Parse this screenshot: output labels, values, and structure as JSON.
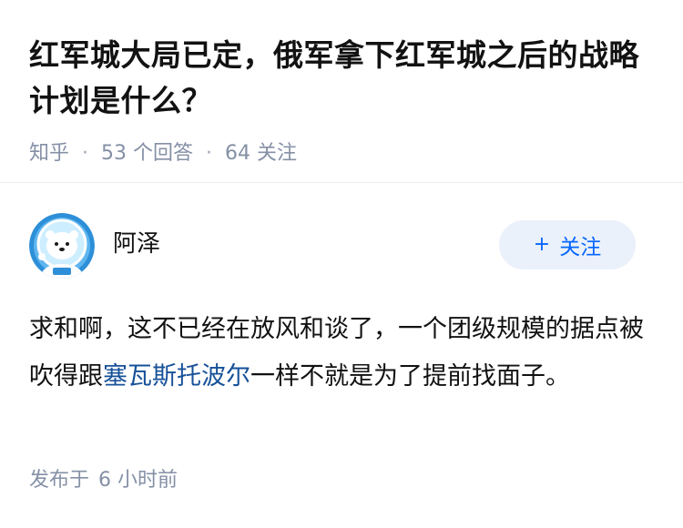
{
  "question": {
    "title": "红军城大局已定，俄军拿下红军城之后的战略计划是什么？",
    "source": "知乎",
    "answer_count": "53",
    "answer_label": "个回答",
    "follower_count": "64",
    "follower_label": "关注",
    "separator": "·"
  },
  "answer": {
    "author_name": "阿泽",
    "avatar_icon": "polar-bear-avatar-icon",
    "follow_button_label": "关注",
    "follow_icon": "plus-icon",
    "content_part1": "求和啊，这不已经在放风和谈了，一个团级规模的据点被吹得跟",
    "content_link": "塞瓦斯托波尔",
    "content_part2": "一样不就是为了提前找面子。",
    "published_label": "发布于",
    "published_time": "6 小时前"
  },
  "colors": {
    "text_primary": "#121212",
    "text_meta": "#8590a6",
    "link": "#175199",
    "follow_button_bg": "#ebf1fa",
    "follow_button_text": "#0566ff"
  }
}
